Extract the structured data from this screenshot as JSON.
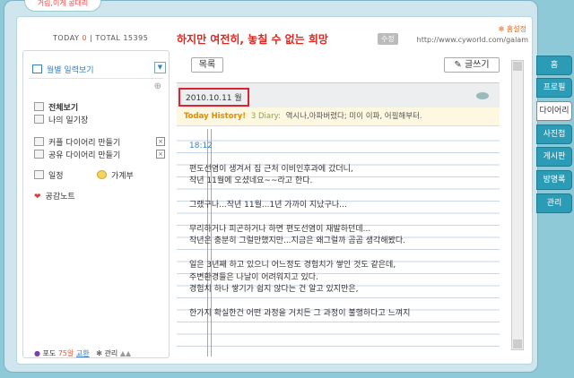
{
  "logo": "거림,이게 콩대리",
  "header": {
    "today_label": "TODAY",
    "today_value": "0",
    "total_label": "TOTAL",
    "total_value": "15395",
    "title": "하지만 여전히, 놓칠 수 없는 희망",
    "badge": "수정",
    "settings": "✻ 홈설정",
    "url": "http://www.cyworld.com/galam"
  },
  "sidebar": {
    "monthly_view": "월별 일력보기",
    "view_all": "전체보기",
    "my_diary": "나의 일기장",
    "couple_diary": "커플 다이어리 만들기",
    "shared_diary": "공유 다이어리 만들기",
    "schedule": "일정",
    "ledger": "가계부",
    "empathy": "공감노트",
    "grapes": "포도",
    "grapes_count": "75알",
    "charge": "교환",
    "manage": "관리"
  },
  "main": {
    "list_button": "목록",
    "write_button": "글쓰기",
    "date": "2010.10.11 월",
    "today_history": "Today History!",
    "diary_count": "3 Diary:",
    "diary_titles": "역시나,아파버렸다; 미이 이파, 어필해부터.",
    "time": "18:12",
    "lines": [
      "편도선염이 생겨서 집 근처 이비인후과에 갔더니,",
      "작년 11월에 오셨네요~~라고 한다.",
      "",
      "그랬구나...작년 11월...1년 가까이 지났구나...",
      "",
      "무리하거나 피곤하거나 하면 편도선염이 재발하던데...",
      "작년은 충분히 그럴만했지만...지금은 왜그럴까 곰곰 생각해봤다.",
      "",
      "일은 3년째 하고 있으니 어느정도 경험치가 쌓인 것도 같은데,",
      "주변환경들은 나날이 어려워지고 있다.",
      "경험치 하나 쌓기가 쉽지 않다는 건 알고 있지만은,",
      "",
      "한가지 확실한건 어떤 과정을 거치든 그 과정이 불행하다고 느껴지"
    ]
  },
  "tabs": [
    "홈",
    "프로필",
    "다이어리",
    "사진첩",
    "게시판",
    "방명록",
    "관리"
  ],
  "active_tab": "다이어리"
}
